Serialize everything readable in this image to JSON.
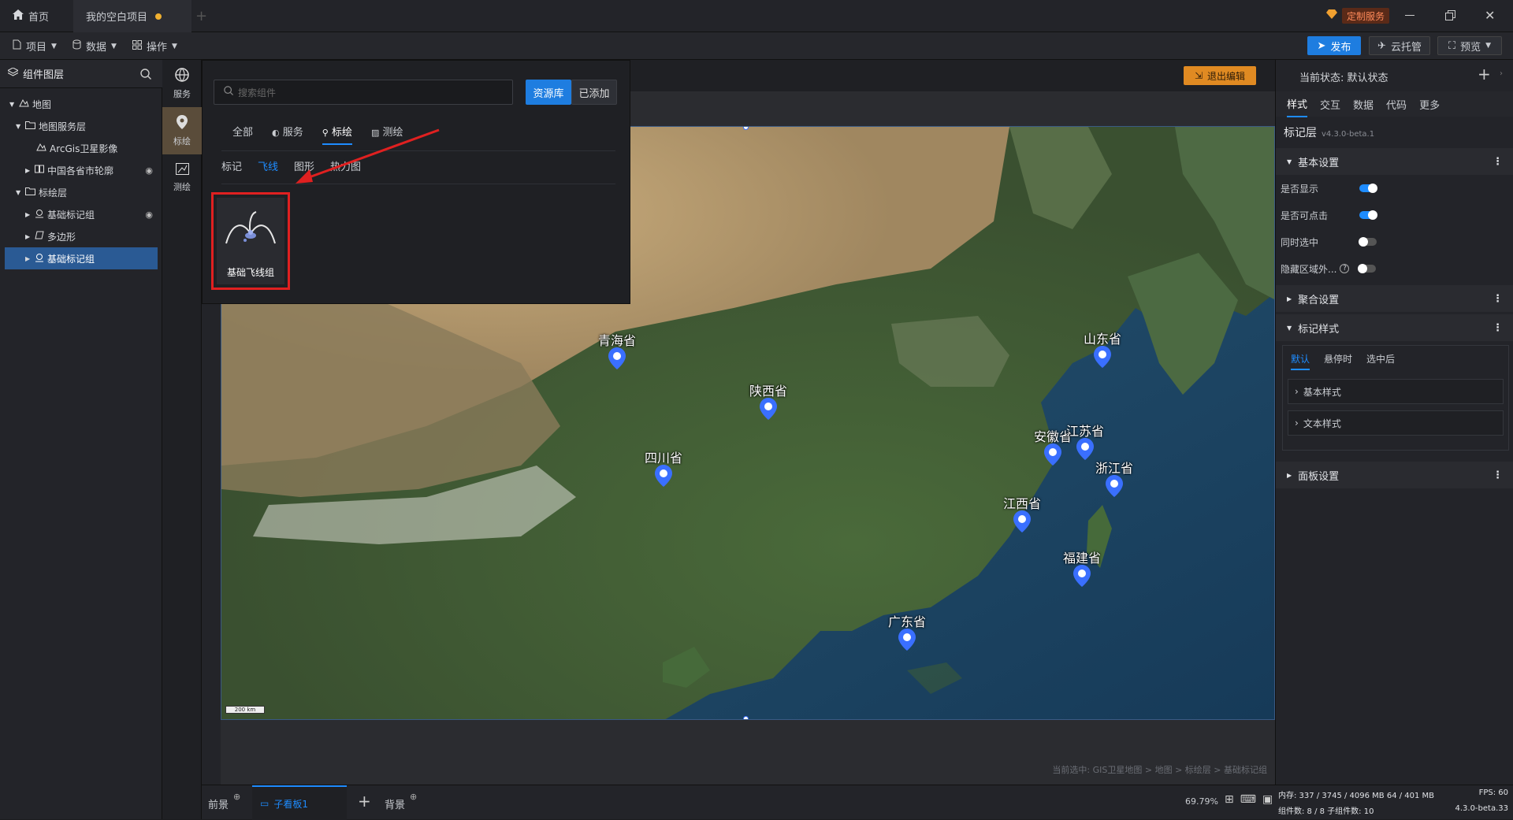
{
  "tabs": [
    {
      "label": "首页"
    },
    {
      "label": "我的空白项目"
    }
  ],
  "titlebar": {
    "custom_service": "定制服务"
  },
  "menu": {
    "project": "项目",
    "data": "数据",
    "operate": "操作"
  },
  "toolbar": {
    "publish": "发布",
    "cloud": "云托管",
    "preview": "预览"
  },
  "layers": {
    "title": "组件图层",
    "items": [
      {
        "label": "地图"
      },
      {
        "label": "地图服务层"
      },
      {
        "label": "ArcGis卫星影像"
      },
      {
        "label": "中国各省市轮廓"
      },
      {
        "label": "标绘层"
      },
      {
        "label": "基础标记组"
      },
      {
        "label": "多边形"
      },
      {
        "label": "基础标记组"
      }
    ]
  },
  "sidebar_icons": [
    {
      "label": "服务"
    },
    {
      "label": "标绘"
    },
    {
      "label": "测绘"
    }
  ],
  "popup": {
    "search_placeholder": "搜索组件",
    "tab_library": "资源库",
    "tab_added": "已添加",
    "categories": [
      "全部",
      "服务",
      "标绘",
      "测绘"
    ],
    "subcategories": [
      "标记",
      "飞线",
      "图形",
      "热力图"
    ],
    "card_label": "基础飞线组"
  },
  "exit_edit": "退出编辑",
  "map": {
    "scale": "200 km",
    "markers": [
      {
        "label": "青海省"
      },
      {
        "label": "陕西省"
      },
      {
        "label": "山东省"
      },
      {
        "label": "四川省"
      },
      {
        "label": "安徽省"
      },
      {
        "label": "江苏省"
      },
      {
        "label": "浙江省"
      },
      {
        "label": "江西省"
      },
      {
        "label": "福建省"
      },
      {
        "label": "广东省"
      }
    ]
  },
  "breadcrumb": "当前选中: GIS卫星地图 > 地图 > 标绘层 > 基础标记组",
  "bottom": {
    "front": "前景",
    "board": "子看板1",
    "back": "背景",
    "zoom": "69.79%"
  },
  "right": {
    "state_label": "当前状态: 默认状态",
    "tabs": [
      "样式",
      "交互",
      "数据",
      "代码",
      "更多"
    ],
    "layer_title": "标记层",
    "version": "v4.3.0-beta.1",
    "basic_settings": "基本设置",
    "rows": [
      "是否显示",
      "是否可点击",
      "同时选中",
      "隐藏区域外..."
    ],
    "aggregation": "聚合设置",
    "marker_style": "标记样式",
    "state_tabs": [
      "默认",
      "悬停时",
      "选中后"
    ],
    "sub_sections": [
      "基本样式",
      "文本样式"
    ],
    "panel_settings": "面板设置"
  },
  "status": {
    "memory": "内存: 337 / 3745 / 4096 MB  64 / 401 MB",
    "fps": "FPS: 60",
    "components": "组件数: 8 / 8   子组件数: 10",
    "version": "4.3.0-beta.33"
  },
  "colors": {
    "accent": "#1e8cff",
    "orange": "#e08a22",
    "red": "#e02020",
    "marker": "#3a6fff"
  }
}
